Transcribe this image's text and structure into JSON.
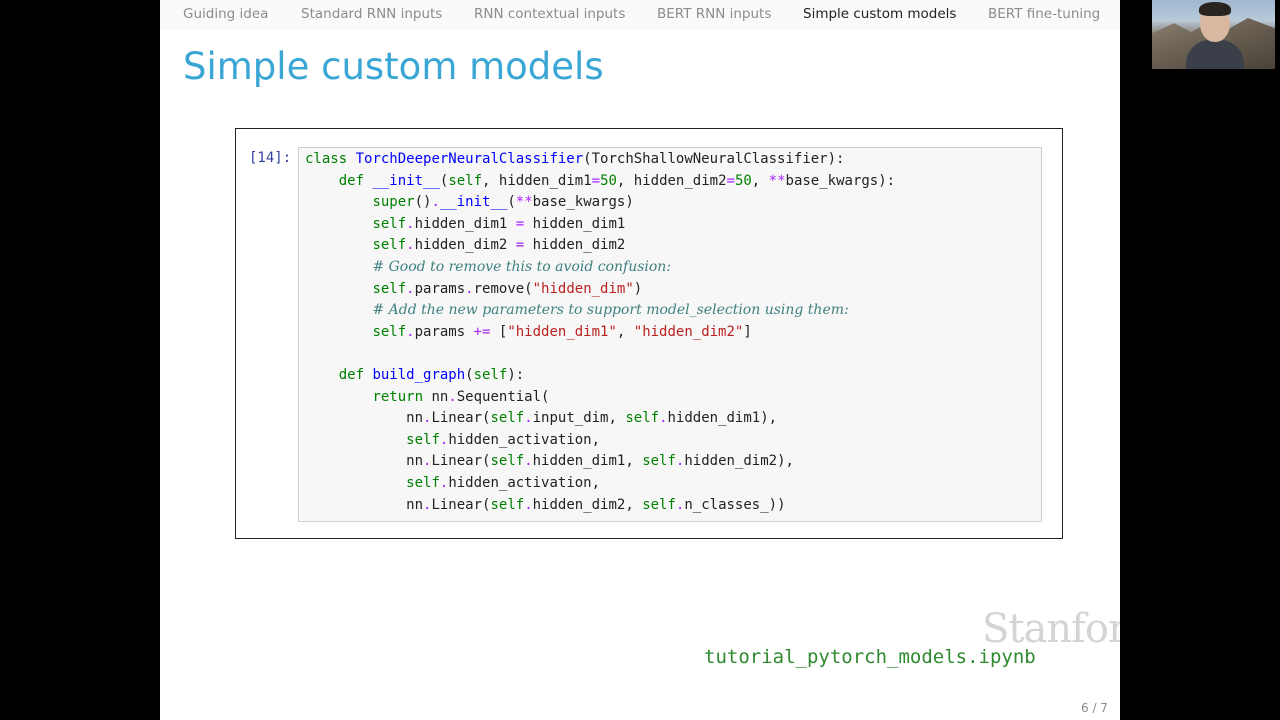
{
  "nav": {
    "items": [
      {
        "label": "Guiding idea"
      },
      {
        "label": "Standard RNN inputs"
      },
      {
        "label": "RNN contextual inputs"
      },
      {
        "label": "BERT RNN inputs"
      },
      {
        "label": "Simple custom models"
      },
      {
        "label": "BERT fine-tuning"
      }
    ],
    "active": "Simple custom models"
  },
  "slide": {
    "title": "Simple custom models",
    "prompt": "[14]:",
    "code_lines": [
      "class TorchDeeperNeuralClassifier(TorchShallowNeuralClassifier):",
      "    def __init__(self, hidden_dim1=50, hidden_dim2=50, **base_kwargs):",
      "        super().__init__(**base_kwargs)",
      "        self.hidden_dim1 = hidden_dim1",
      "        self.hidden_dim2 = hidden_dim2",
      "        # Good to remove this to avoid confusion:",
      "        self.params.remove(\"hidden_dim\")",
      "        # Add the new parameters to support model_selection using them:",
      "        self.params += [\"hidden_dim1\", \"hidden_dim2\"]",
      "",
      "    def build_graph(self):",
      "        return nn.Sequential(",
      "            nn.Linear(self.input_dim, self.hidden_dim1),",
      "            self.hidden_activation,",
      "            nn.Linear(self.hidden_dim1, self.hidden_dim2),",
      "            self.hidden_activation,",
      "            nn.Linear(self.hidden_dim2, self.n_classes_))"
    ],
    "logo": "Stanford",
    "filename": "tutorial_pytorch_models.ipynb",
    "page_number": "6 / 7"
  },
  "colors": {
    "title": "#3aa6d6",
    "prompt": "#303f9f",
    "keyword": "#008000",
    "function_name": "#0000ff",
    "string": "#ba2121",
    "comment": "#408080",
    "filename": "#2f8a2f",
    "slide_background": "#ffffff",
    "outer_background": "#000000"
  },
  "webcam": {
    "icon": "webcam-presenter-video"
  }
}
